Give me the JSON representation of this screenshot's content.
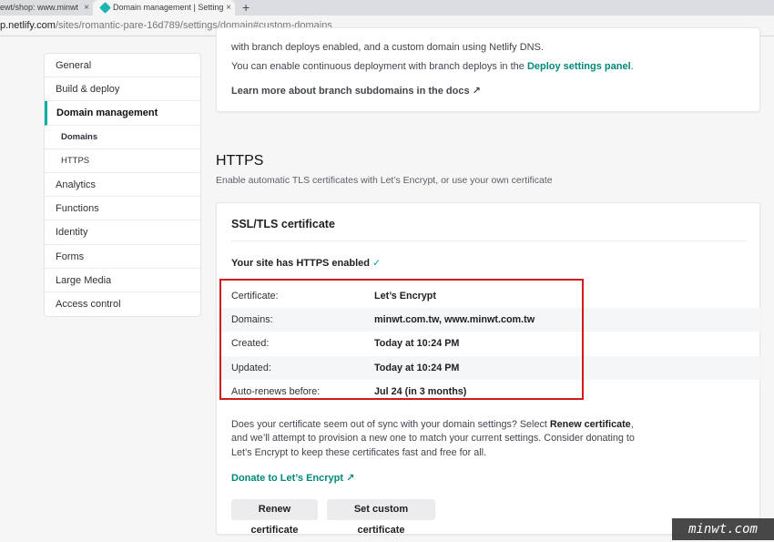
{
  "browser": {
    "tabs": [
      {
        "title": "ewt/shop: www.minwt"
      },
      {
        "title": "Domain management | Settings"
      }
    ],
    "close_glyph": "×",
    "new_tab_glyph": "+",
    "url_host": "p.netlify.com",
    "url_path": "/sites/romantic-pare-16d789/settings/domain#custom-domains"
  },
  "sidebar": {
    "items": [
      {
        "label": "General"
      },
      {
        "label": "Build & deploy"
      },
      {
        "label": "Domain management"
      },
      {
        "label": "Domains"
      },
      {
        "label": "HTTPS"
      },
      {
        "label": "Analytics"
      },
      {
        "label": "Functions"
      },
      {
        "label": "Identity"
      },
      {
        "label": "Forms"
      },
      {
        "label": "Large Media"
      },
      {
        "label": "Access control"
      }
    ]
  },
  "top_card": {
    "line1": "with branch deploys enabled, and a custom domain using Netlify DNS.",
    "line2_prefix": "You can enable continuous deployment with branch deploys in the ",
    "line2_link": "Deploy settings panel",
    "line2_suffix": ".",
    "learn_link": "Learn more about branch subdomains in the docs ↗"
  },
  "https": {
    "title": "HTTPS",
    "description": "Enable automatic TLS certificates with Let’s Encrypt, or use your own certificate"
  },
  "ssl_card": {
    "title": "SSL/TLS certificate",
    "status": "Your site has HTTPS enabled",
    "check": "✓",
    "rows": [
      {
        "label": "Certificate:",
        "value": "Let’s Encrypt"
      },
      {
        "label": "Domains:",
        "value": "minwt.com.tw, www.minwt.com.tw"
      },
      {
        "label": "Created:",
        "value": "Today at 10:24 PM"
      },
      {
        "label": "Updated:",
        "value": "Today at 10:24 PM"
      },
      {
        "label": "Auto-renews before:",
        "value": "Jul 24 (in 3 months)"
      }
    ],
    "sync_text_1": "Does your certificate seem out of sync with your domain settings? Select ",
    "sync_text_bold": "Renew certificate",
    "sync_text_2": ", and we’ll attempt to provision a new one to match your current settings. Consider donating to Let’s Encrypt to keep these certificates fast and free for all.",
    "donate_link": "Donate to Let’s Encrypt ↗",
    "renew_button": "Renew certificate",
    "custom_button": "Set custom certificate"
  },
  "watermark": "minwt.com",
  "colors": {
    "accent": "#00ad9f",
    "link": "#00897b",
    "highlight": "#d11a1a"
  }
}
